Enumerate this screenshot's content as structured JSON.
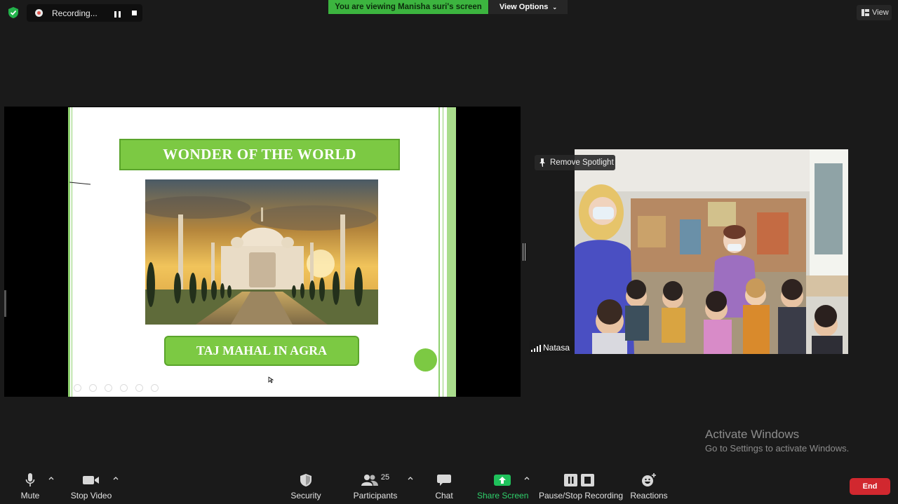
{
  "top_bar": {
    "recording_label": "Recording...",
    "viewing_banner": "You are viewing Manisha suri's screen",
    "view_options_label": "View Options",
    "view_label": "View"
  },
  "shared_screen": {
    "slide_title": "WONDER OF THE WORLD",
    "slide_caption": "TAJ MAHAL IN AGRA"
  },
  "spotlight": {
    "remove_spotlight_label": "Remove Spotlight",
    "participant_name": "Natasa"
  },
  "watermark": {
    "title": "Activate Windows",
    "subtitle": "Go to Settings to activate Windows."
  },
  "toolbar": {
    "mute_label": "Mute",
    "stop_video_label": "Stop Video",
    "security_label": "Security",
    "participants_label": "Participants",
    "participants_count": "25",
    "chat_label": "Chat",
    "share_screen_label": "Share Screen",
    "recording_label": "Pause/Stop Recording",
    "reactions_label": "Reactions",
    "end_label": "End"
  },
  "colors": {
    "banner_green": "#3cb43f",
    "slide_green": "#7cc943",
    "share_icon_green": "#1fc15b",
    "end_red": "#d1282f",
    "background": "#1a1a1a"
  }
}
